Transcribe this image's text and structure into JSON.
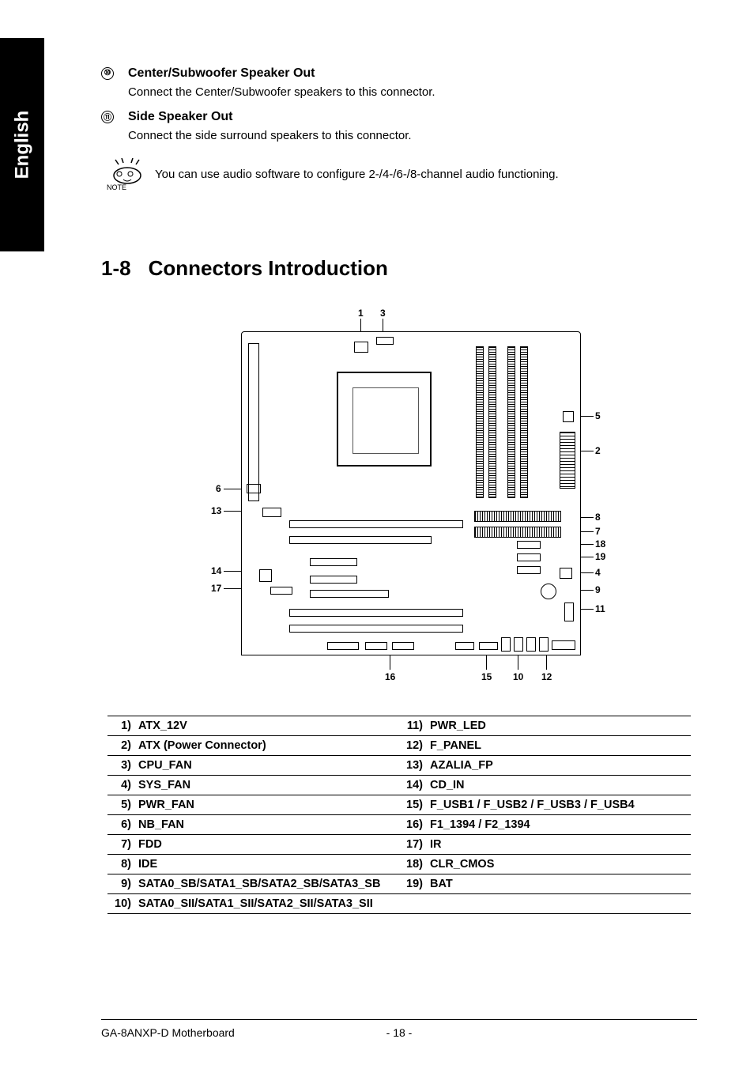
{
  "sidebar": {
    "language": "English"
  },
  "sections": [
    {
      "marker": "⑩",
      "title": "Center/Subwoofer Speaker Out",
      "desc": "Connect the Center/Subwoofer speakers to this connector."
    },
    {
      "marker": "⑪",
      "title": "Side Speaker Out",
      "desc": "Connect the side surround speakers to this connector."
    }
  ],
  "note": {
    "label": "NOTE",
    "text": "You can use audio software to configure 2-/4-/6-/8-channel audio functioning."
  },
  "heading": {
    "num": "1-8",
    "title": "Connectors Introduction"
  },
  "diagram_labels": {
    "top": {
      "l1": "1",
      "l3": "3"
    },
    "right": {
      "l5": "5",
      "l2": "2",
      "l8": "8",
      "l7": "7",
      "l18": "18",
      "l19": "19",
      "l4": "4",
      "l9": "9",
      "l11": "11"
    },
    "left": {
      "l6": "6",
      "l13": "13",
      "l14": "14",
      "l17": "17"
    },
    "bottom": {
      "l16": "16",
      "l15": "15",
      "l10": "10",
      "l12": "12"
    }
  },
  "connectors_left": [
    {
      "n": "1)",
      "name": "ATX_12V"
    },
    {
      "n": "2)",
      "name": "ATX (Power Connector)"
    },
    {
      "n": "3)",
      "name": "CPU_FAN"
    },
    {
      "n": "4)",
      "name": "SYS_FAN"
    },
    {
      "n": "5)",
      "name": "PWR_FAN"
    },
    {
      "n": "6)",
      "name": "NB_FAN"
    },
    {
      "n": "7)",
      "name": "FDD"
    },
    {
      "n": "8)",
      "name": "IDE"
    },
    {
      "n": "9)",
      "name": "SATA0_SB/SATA1_SB/SATA2_SB/SATA3_SB"
    },
    {
      "n": "10)",
      "name": "SATA0_SII/SATA1_SII/SATA2_SII/SATA3_SII"
    }
  ],
  "connectors_right": [
    {
      "n": "11)",
      "name": "PWR_LED"
    },
    {
      "n": "12)",
      "name": "F_PANEL"
    },
    {
      "n": "13)",
      "name": "AZALIA_FP"
    },
    {
      "n": "14)",
      "name": "CD_IN"
    },
    {
      "n": "15)",
      "name": "F_USB1 / F_USB2 / F_USB3 / F_USB4"
    },
    {
      "n": "16)",
      "name": "F1_1394 / F2_1394"
    },
    {
      "n": "17)",
      "name": "IR"
    },
    {
      "n": "18)",
      "name": "CLR_CMOS"
    },
    {
      "n": "19)",
      "name": "BAT"
    },
    {
      "n": "",
      "name": ""
    }
  ],
  "footer": {
    "left": "GA-8ANXP-D Motherboard",
    "center": "- 18 -",
    "right": ""
  }
}
